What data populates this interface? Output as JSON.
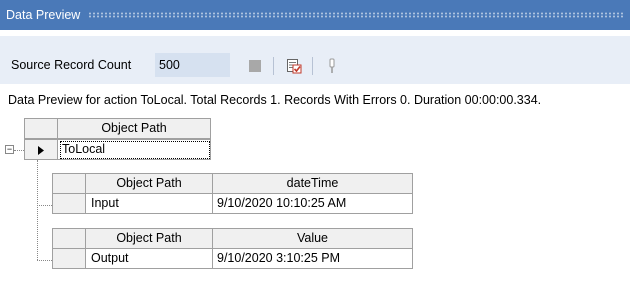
{
  "panel": {
    "title": "Data Preview"
  },
  "toolbar": {
    "source_record_count_label": "Source Record Count",
    "source_record_count_value": "500",
    "icons": [
      "stop-icon",
      "preview-icon",
      "pin-icon"
    ]
  },
  "status": "Data Preview for action ToLocal. Total Records 1. Records With Errors 0. Duration 00:00:00.334.",
  "grid": {
    "root_header": "Object Path",
    "root_row": "ToLocal",
    "children": [
      {
        "headers": [
          "Object Path",
          "dateTime"
        ],
        "row": [
          "Input",
          "9/10/2020 10:10:25 AM"
        ]
      },
      {
        "headers": [
          "Object Path",
          "Value"
        ],
        "row": [
          "Output",
          "9/10/2020 3:10:25 PM"
        ]
      }
    ]
  }
}
